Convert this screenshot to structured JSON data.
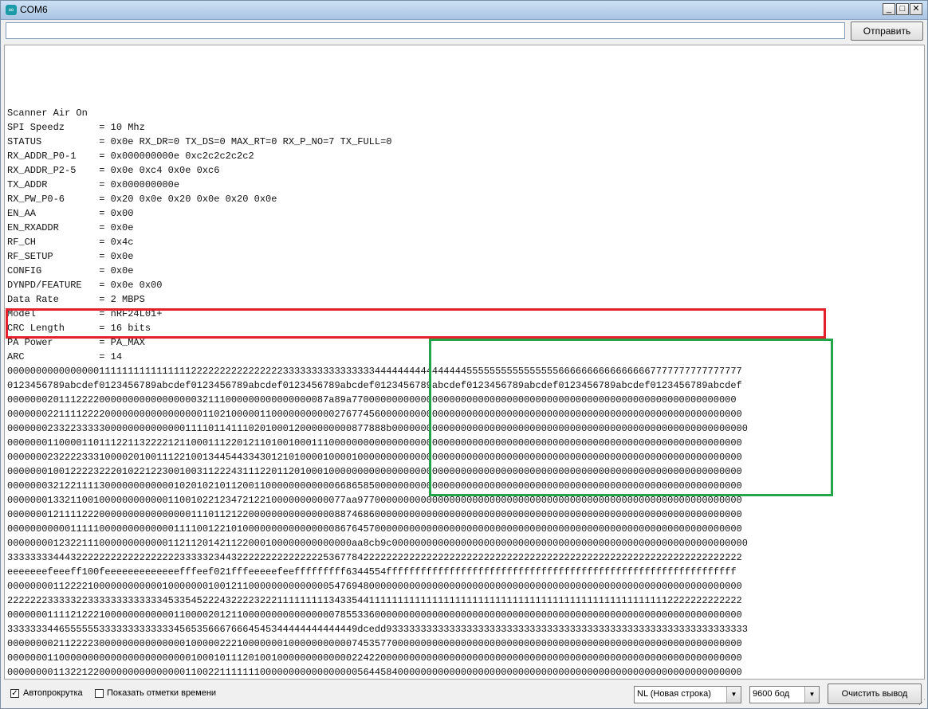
{
  "window": {
    "title": "COM6",
    "icon_label": "∞"
  },
  "window_controls": {
    "minimize": "_",
    "maximize": "□",
    "close": "✕"
  },
  "send": {
    "input_value": "",
    "button_label": "Отправить"
  },
  "output": {
    "lines": [
      "Scanner Air On",
      "SPI Speedz      = 10 Mhz",
      "STATUS          = 0x0e RX_DR=0 TX_DS=0 MAX_RT=0 RX_P_NO=7 TX_FULL=0",
      "RX_ADDR_P0-1    = 0x000000000e 0xc2c2c2c2c2",
      "RX_ADDR_P2-5    = 0x0e 0xc4 0x0e 0xc6",
      "TX_ADDR         = 0x000000000e",
      "RX_PW_P0-6      = 0x20 0x0e 0x20 0x0e 0x20 0x0e",
      "EN_AA           = 0x00",
      "EN_RXADDR       = 0x0e",
      "RF_CH           = 0x4c",
      "RF_SETUP        = 0x0e",
      "CONFIG          = 0x0e",
      "DYNPD/FEATURE   = 0x0e 0x00",
      "Data Rate       = 2 MBPS",
      "Model           = nRF24L01+",
      "CRC Length      = 16 bits",
      "PA Power        = PA_MAX",
      "ARC             = 14",
      "00000000000000001111111111111111222222222222222233333333333333334444444444444444555555555555555566666666666666667777777777777777",
      "0123456789abcdef0123456789abcdef0123456789abcdef0123456789abcdef0123456789abcdef0123456789abcdef0123456789abcdef0123456789abcdef",
      "00000002011122220000000000000000032111000000000000000087a89a7700000000000000000000000000000000000000000000000000000000000000000",
      "00000002211112222000000000000000001102100000110000000000027677456000000000000000000000000000000000000000000000000000000000000000",
      "000000023322333330000000000000011110114111020100012000000000877888b00000000000000000000000000000000000000000000000000000000000000",
      "00000001100001101112211322221211000111220121101001000111000000000000000000000000000000000000000000000000000000000000000000000000",
      "00000002322223331000020100111221001344544334301210100001000010000000000000000000000000000000000000000000000000000000000000000000",
      "00000001001222232220102212230010031122243111220112010001000000000000000000000000000000000000000000000000000000000000000000000000",
      "00000003212211113000000000000102010210112001100000000000066865850000000000000000000000000000000000000000000000000000000000000000",
      "00000001332110010000000000001100102212347212210000000000077aa9770000000000000000000000000000000000000000000000000000000000000000",
      "00000001211112220000000000000000111011212200000000000000088746860000000000000000000000000000000000000000000000000000000000000000",
      "00000000000111110000000000000111100122101000000000000000086764570000000000000000000000000000000000000000000000000000000000000000",
      "000000001232211100000000000011211201421122000100000000000000aa8cb9c00000000000000000000000000000000000000000000000000000000000000",
      "33333333444322222222222222222233333234432222222222222225367784222222222222222222222222222222222222222222222222222222222222222222",
      "eeeeeeefeeeff100feeeeeeeeeeeeefffeef021fffeeeeefeefffffffff6344554fffffffffffffffffffffffffffffffffffffffffffffffffffffffffffff",
      "00000000112222100000000000010000000100121100000000000000547694800000000000000000000000000000000000000000000000000000000000000000",
      "22222223333322333333333333345335452224322223222111111111343354411111111111111111111111111111111111111111111111111112222222222222",
      "00000001111212221000000000000110000201211000000000000000078553360000000000000000000000000000000000000000000000000000000000000000",
      "3333333446555555333333333333345653566676664545344444444444449dcedd933333333333333333333333333333333333333333333333333333333333333",
      "00000000211222230000000000000001000002221000000010000000000074535770000000000000000000000000000000000000000000000000000000000000",
      "00000001100000000000000000000000100010111201001000000000000022422000000000000000000000000000000000000000000000000000000000000000",
      "00000000113221220000000000000001100221111111000000000000000005644584000000000000000000000000000000000000000000000000000000000000"
    ]
  },
  "footer": {
    "autoscroll": {
      "label": "Автопрокрутка",
      "checked": true,
      "mark": "✓"
    },
    "timestamps": {
      "label": "Показать отметки времени",
      "checked": false
    },
    "line_ending": {
      "value": "NL (Новая строка)",
      "arrow": "▼"
    },
    "baud": {
      "value": "9600 бод",
      "arrow": "▼"
    },
    "clear_label": "Очистить вывод"
  },
  "colors": {
    "highlight_red": "#e4202b",
    "highlight_green": "#25a54a"
  }
}
